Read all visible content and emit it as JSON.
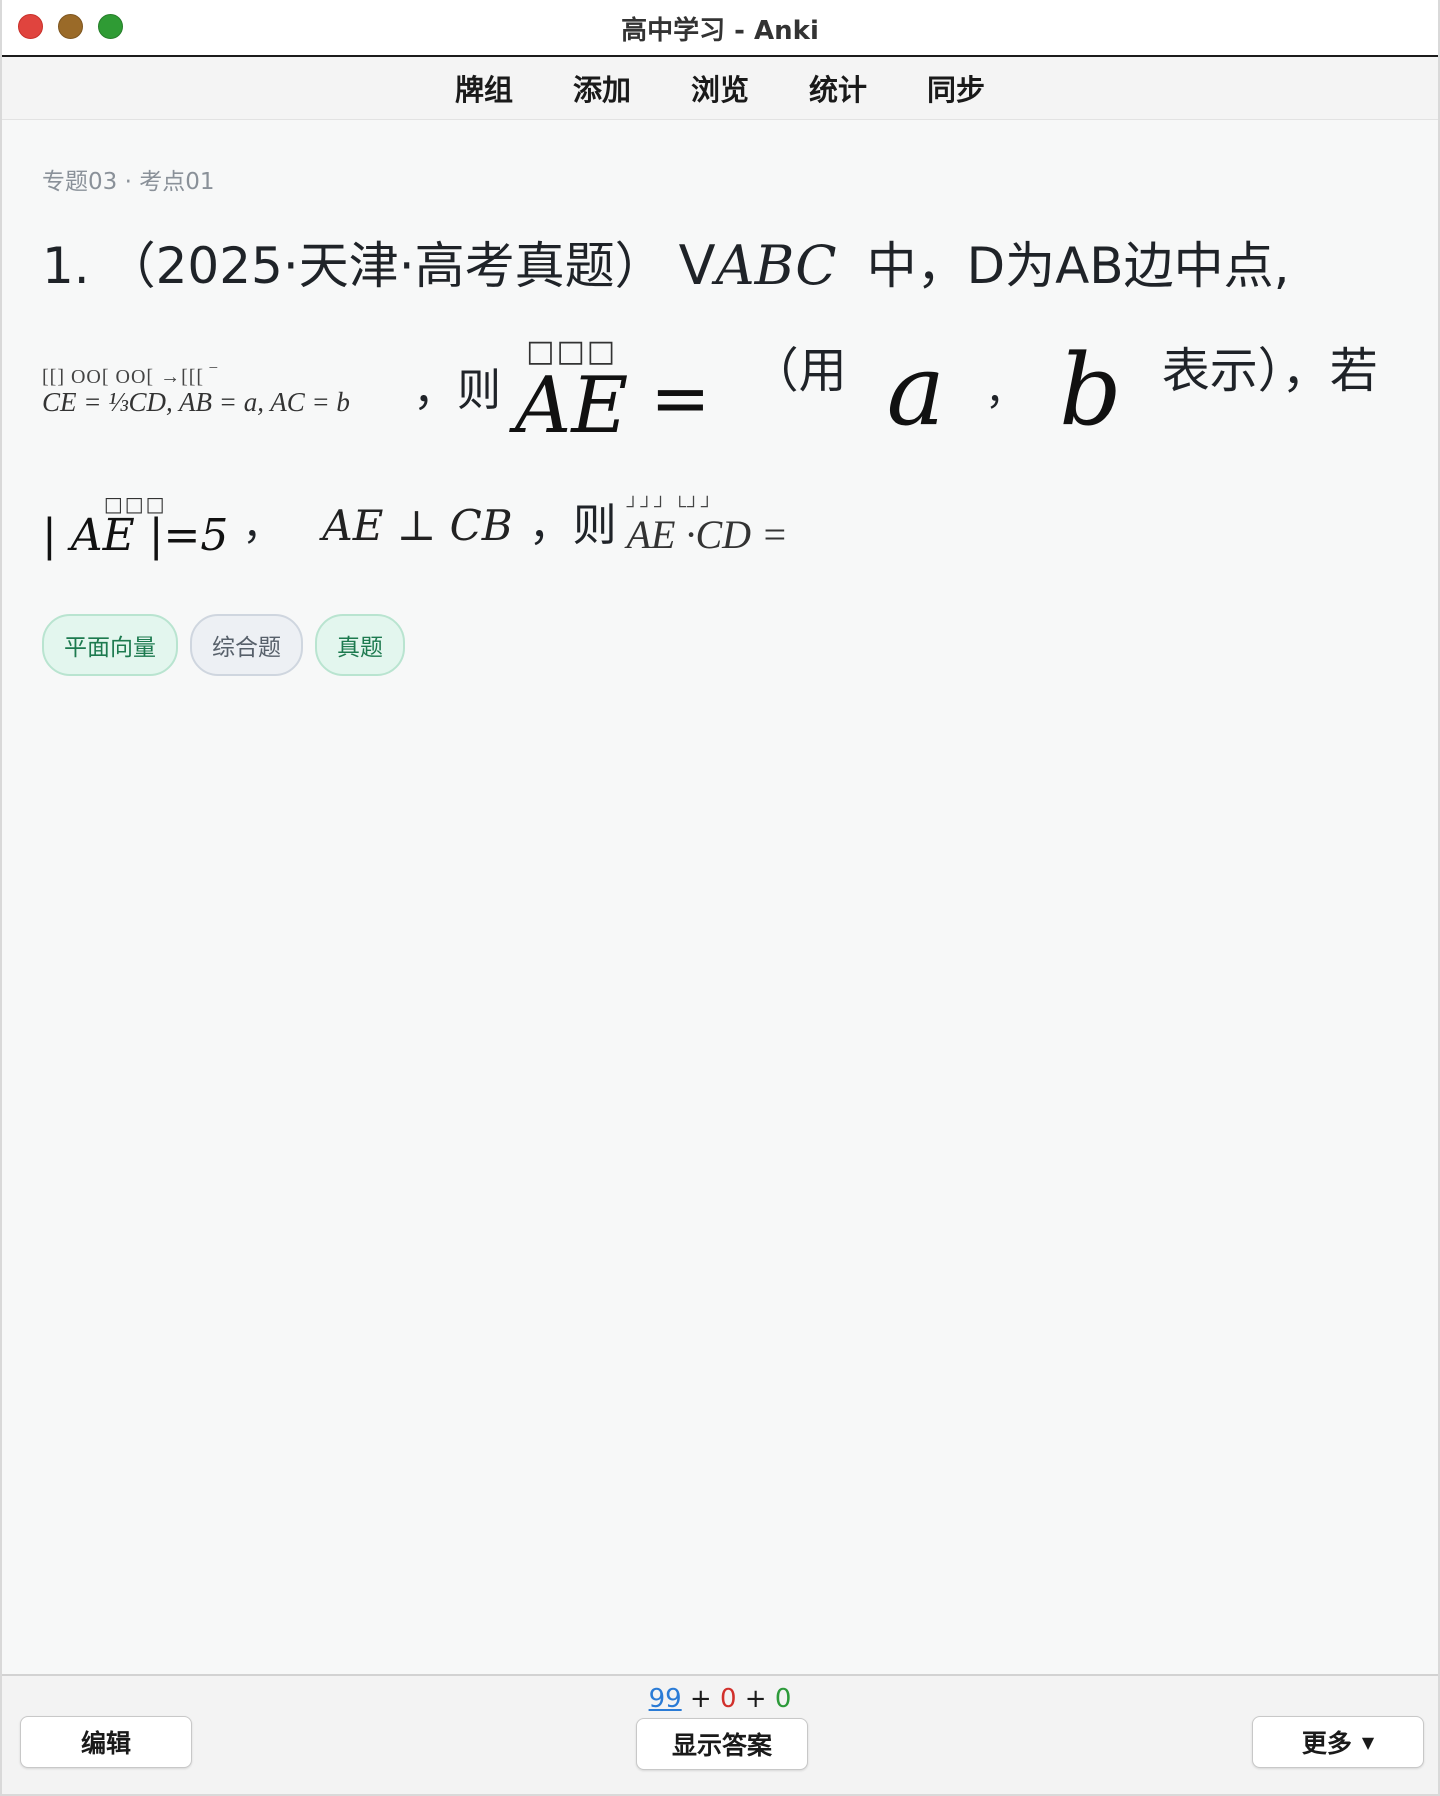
{
  "window": {
    "title": "高中学习 - Anki"
  },
  "menu": {
    "items": [
      "牌组",
      "添加",
      "浏览",
      "统计",
      "同步"
    ]
  },
  "card": {
    "breadcrumb": "专题03 · 考点01",
    "question": {
      "line1_prefix": "1. （2025·天津·高考真题）",
      "line1_triangle": "V",
      "line1_abc": "ABC",
      "line1_suffix": "中，D为AB边中点,",
      "line2_formula_boxes": "[[]   ΟΟ[   ΟΟ[   →[[[   ‾",
      "line2_formula": "CE = ⅓CD, AB = a, AC = b",
      "line2_sep": "，则",
      "line2_vec_boxes": "□□□",
      "line2_vec": "AE",
      "line2_eq": "=",
      "line2_paren": "（用",
      "line2_a": "a",
      "line2_comma": "，",
      "line2_b": "b",
      "line2_suffix": "表示），若",
      "line3_boxes": "□□□",
      "line3_abs": "| AE |=5",
      "line3_comma": "，",
      "line3_perp": "AE ⊥ CB",
      "line3_sep": "，则",
      "line3_dot_boxes": "┘┘┘ └┘┘",
      "line3_dot": "AE ·CD ="
    },
    "tags": [
      {
        "label": "平面向量",
        "style": "green"
      },
      {
        "label": "综合题",
        "style": "gray"
      },
      {
        "label": "真题",
        "style": "green"
      }
    ]
  },
  "bottom": {
    "edit_label": "编辑",
    "show_answer_label": "显示答案",
    "more_label": "更多",
    "counts": {
      "new": "99",
      "plus1": " + ",
      "learning": "0",
      "plus2": " + ",
      "review": "0"
    }
  },
  "colors": {
    "new_count": "#2a7bd6",
    "learning_count": "#d1302b",
    "review_count": "#2d9a3a",
    "tag_green": "#1d7a4f"
  },
  "icons": [
    "traffic-close-icon",
    "traffic-minimize-icon",
    "traffic-maximize-icon",
    "caret-down-icon"
  ]
}
